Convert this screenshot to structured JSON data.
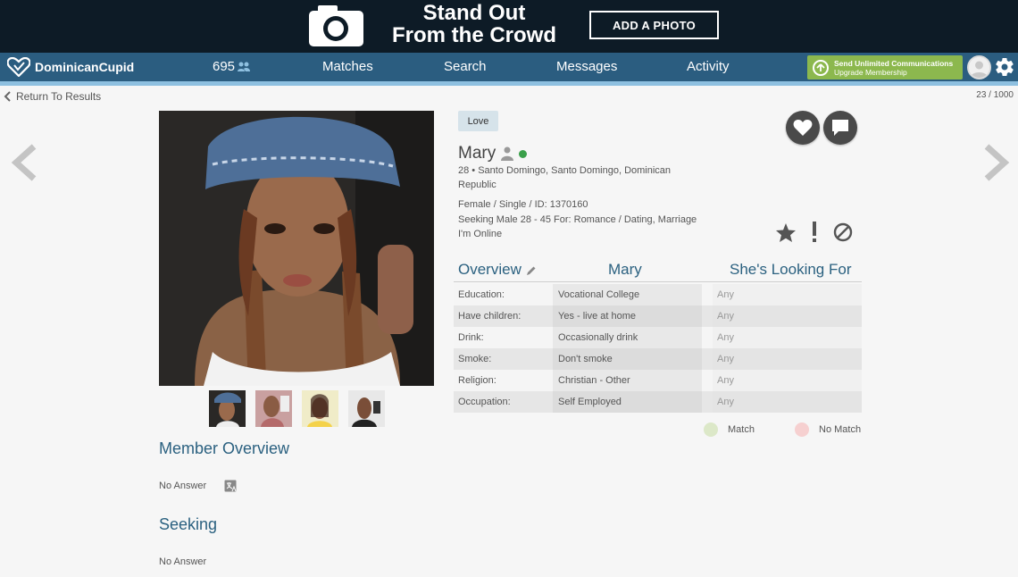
{
  "banner": {
    "headline_1": "Stand Out",
    "headline_2": "From the Crowd",
    "cta": "ADD A PHOTO"
  },
  "nav": {
    "logo": "DominicanCupid",
    "count": "695",
    "items": [
      "Matches",
      "Search",
      "Messages",
      "Activity"
    ],
    "upgrade_line1": "Send Unlimited Communications",
    "upgrade_line2": "Upgrade Membership"
  },
  "subbar": {
    "back": "Return To Results",
    "pager": "23 / 1000"
  },
  "profile": {
    "tag": "Love",
    "name": "Mary",
    "location_1": "28 • Santo Domingo, Santo Domingo, Dominican",
    "location_2": "Republic",
    "details": "Female / Single / ID: 1370160",
    "seeking": "Seeking Male 28 - 45 For: Romance / Dating, Marriage",
    "status": "I'm Online"
  },
  "table": {
    "col_overview": "Overview",
    "col_name": "Mary",
    "col_looking": "She's Looking For",
    "rows": [
      {
        "label": "Education:",
        "value": "Vocational College",
        "looking": "Any"
      },
      {
        "label": "Have children:",
        "value": "Yes - live at home",
        "looking": "Any"
      },
      {
        "label": "Drink:",
        "value": "Occasionally drink",
        "looking": "Any"
      },
      {
        "label": "Smoke:",
        "value": "Don't smoke",
        "looking": "Any"
      },
      {
        "label": "Religion:",
        "value": "Christian - Other",
        "looking": "Any"
      },
      {
        "label": "Occupation:",
        "value": "Self Employed",
        "looking": "Any"
      }
    ]
  },
  "legend": {
    "match": "Match",
    "no_match": "No Match",
    "match_color": "#dce8c8",
    "no_match_color": "#f6d0d0"
  },
  "member_overview": {
    "title": "Member Overview",
    "text": "No Answer"
  },
  "seeking_section": {
    "title": "Seeking",
    "text": "No Answer"
  }
}
